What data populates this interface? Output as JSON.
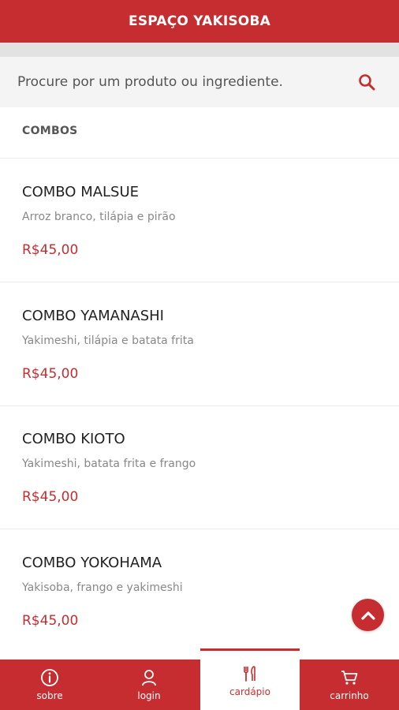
{
  "header": {
    "title": "ESPAÇO YAKISOBA"
  },
  "search": {
    "placeholder": "Procure por um produto ou ingrediente."
  },
  "section": {
    "title": "COMBOS"
  },
  "items": [
    {
      "name": "COMBO MALSUE",
      "description": "Arroz branco, tilápia e pirão",
      "price": "R$45,00"
    },
    {
      "name": "COMBO YAMANASHI",
      "description": "Yakimeshi, tilápia e batata frita",
      "price": "R$45,00"
    },
    {
      "name": "COMBO KIOTO",
      "description": "Yakimeshi, batata frita e frango",
      "price": "R$45,00"
    },
    {
      "name": "COMBO YOKOHAMA",
      "description": "Yakisoba, frango e yakimeshi",
      "price": "R$45,00"
    }
  ],
  "nav": [
    {
      "label": "sobre",
      "icon": "info-icon"
    },
    {
      "label": "login",
      "icon": "user-icon"
    },
    {
      "label": "cardápio",
      "icon": "cutlery-icon",
      "active": true
    },
    {
      "label": "carrinho",
      "icon": "cart-icon"
    }
  ],
  "colors": {
    "accent": "#c62d30",
    "text": "#222222",
    "muted": "#888888"
  }
}
